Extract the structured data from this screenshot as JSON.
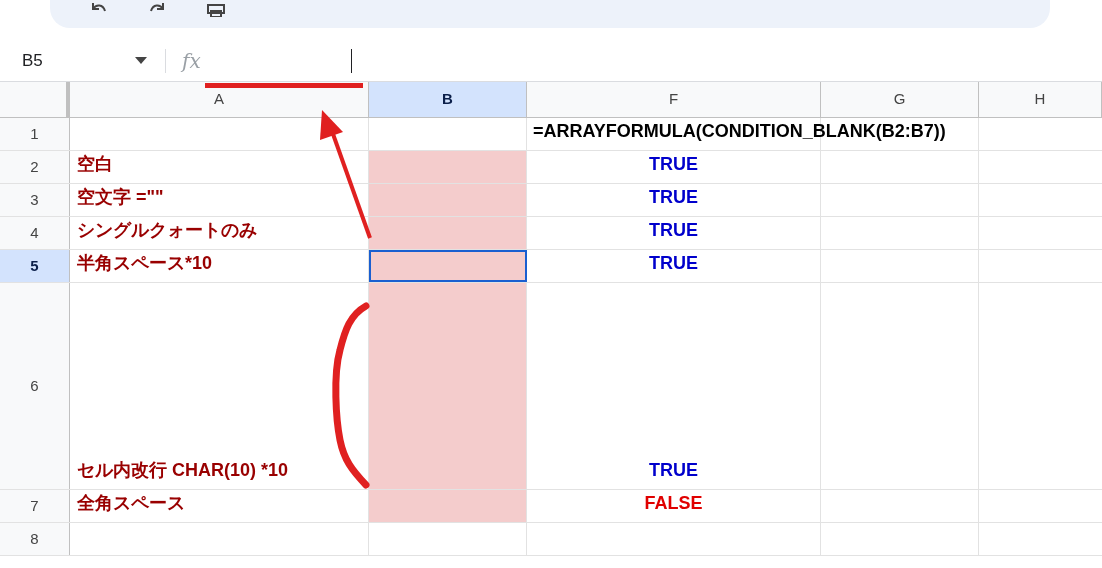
{
  "name_box": "B5",
  "formula_label": "fx",
  "columns": [
    {
      "label": "A",
      "selected": false
    },
    {
      "label": "B",
      "selected": true
    },
    {
      "label": "F",
      "selected": false
    },
    {
      "label": "G",
      "selected": false
    },
    {
      "label": "H",
      "selected": false
    }
  ],
  "rows": [
    {
      "number": "1",
      "selected": false,
      "tall": false,
      "a": "",
      "b_highlighted": false,
      "b_active": false,
      "f": {
        "text": "=ARRAYFORMULA(CONDITION_BLANK(B2:B7))",
        "color": "#000000",
        "kind": "formula"
      }
    },
    {
      "number": "2",
      "selected": false,
      "tall": false,
      "a": "空白",
      "b_highlighted": true,
      "b_active": false,
      "f": {
        "text": "TRUE",
        "color": "#0000cc",
        "kind": "value"
      }
    },
    {
      "number": "3",
      "selected": false,
      "tall": false,
      "a": "空文字 =\"\"",
      "b_highlighted": true,
      "b_active": false,
      "f": {
        "text": "TRUE",
        "color": "#0000cc",
        "kind": "value"
      }
    },
    {
      "number": "4",
      "selected": false,
      "tall": false,
      "a": "シングルクォートのみ",
      "b_highlighted": true,
      "b_active": false,
      "f": {
        "text": "TRUE",
        "color": "#0000cc",
        "kind": "value"
      }
    },
    {
      "number": "5",
      "selected": true,
      "tall": false,
      "a": "半角スペース*10",
      "b_highlighted": true,
      "b_active": true,
      "f": {
        "text": "TRUE",
        "color": "#0000cc",
        "kind": "value"
      }
    },
    {
      "number": "6",
      "selected": false,
      "tall": true,
      "a": "セル内改行 CHAR(10) *10",
      "b_highlighted": true,
      "b_active": false,
      "f": {
        "text": "TRUE",
        "color": "#0000cc",
        "kind": "value"
      }
    },
    {
      "number": "7",
      "selected": false,
      "tall": false,
      "a": "全角スペース",
      "b_highlighted": true,
      "b_active": false,
      "f": {
        "text": "FALSE",
        "color": "#e00000",
        "kind": "value"
      }
    },
    {
      "number": "8",
      "selected": false,
      "tall": false,
      "a": "",
      "b_highlighted": false,
      "b_active": false
    }
  ]
}
